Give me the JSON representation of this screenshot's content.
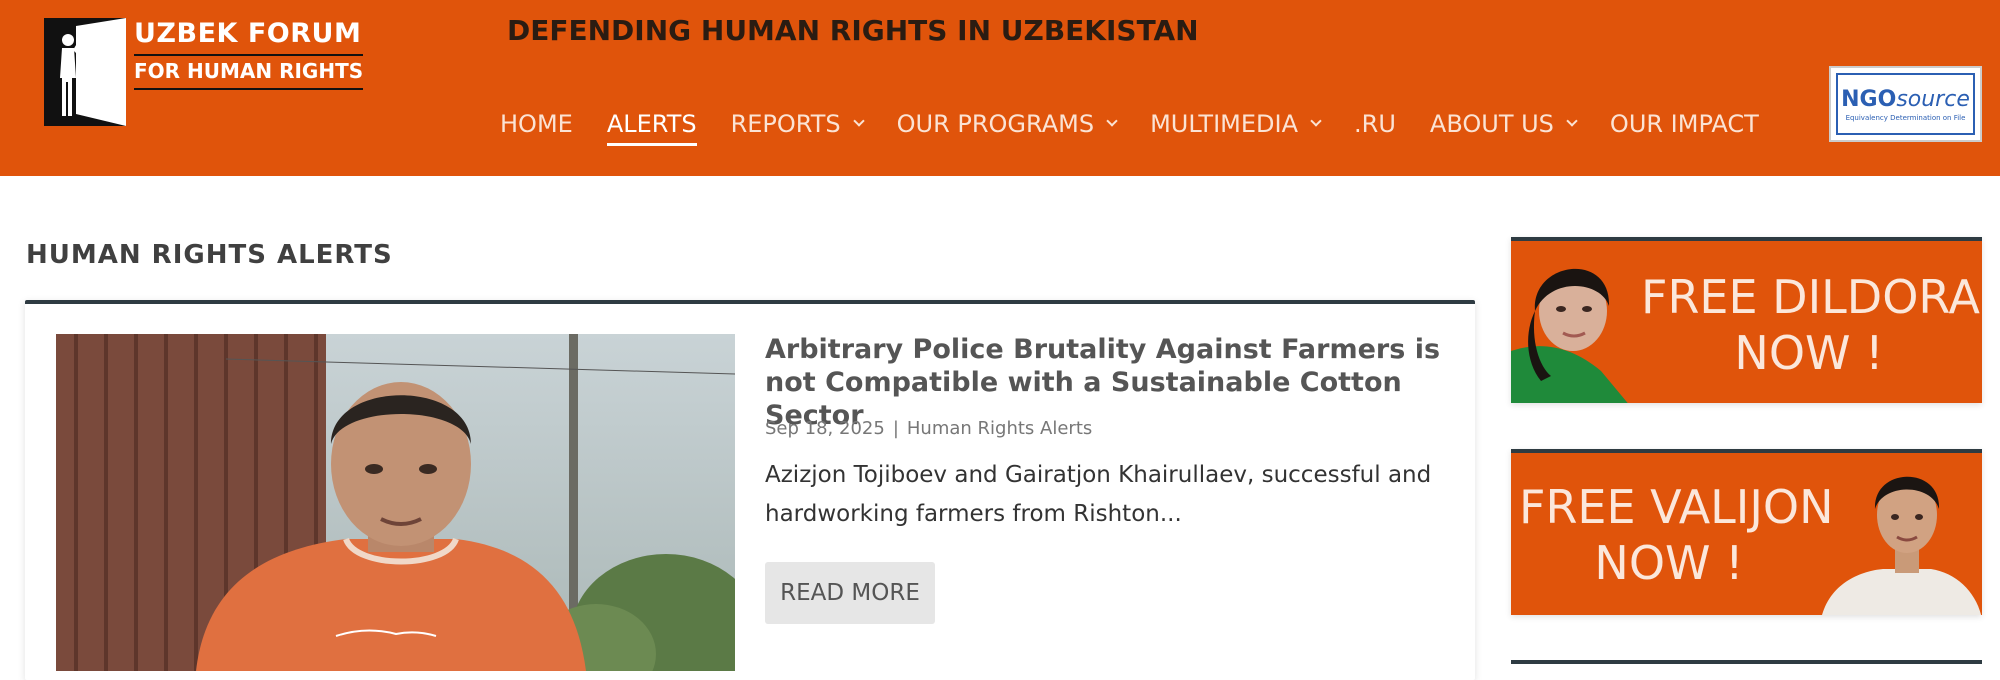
{
  "header": {
    "logo": {
      "line1": "UZBEK FORUM",
      "line2": "FOR HUMAN RIGHTS"
    },
    "tagline": "DEFENDING HUMAN RIGHTS IN UZBEKISTAN",
    "nav": [
      {
        "label": "HOME",
        "dropdown": false,
        "active": false
      },
      {
        "label": "ALERTS",
        "dropdown": false,
        "active": true
      },
      {
        "label": "REPORTS",
        "dropdown": true,
        "active": false
      },
      {
        "label": "OUR PROGRAMS",
        "dropdown": true,
        "active": false
      },
      {
        "label": "MULTIMEDIA",
        "dropdown": true,
        "active": false
      },
      {
        "label": ".RU",
        "dropdown": false,
        "active": false
      },
      {
        "label": "ABOUT US",
        "dropdown": true,
        "active": false
      },
      {
        "label": "OUR IMPACT",
        "dropdown": false,
        "active": false
      }
    ],
    "ngo_badge": {
      "brand_bold": "NGO",
      "brand_italic": "source",
      "subtitle": "Equivalency Determination on File"
    }
  },
  "main": {
    "section_title": "HUMAN RIGHTS ALERTS",
    "article": {
      "title": "Arbitrary Police Brutality Against Farmers is not Compatible with a Sustainable Cotton Sector",
      "date": "Sep 18, 2025",
      "separator": "|",
      "category": "Human Rights Alerts",
      "excerpt": "Azizjon Tojiboev and Gairatjon Khairullaev, successful and hardworking farmers from Rishton...",
      "read_more": "READ MORE"
    }
  },
  "sidebar": {
    "banners": [
      {
        "line1": "FREE DILDORA",
        "line2": "NOW !"
      },
      {
        "line1": "FREE VALIJON",
        "line2": "NOW !"
      }
    ]
  },
  "colors": {
    "brand_orange": "#e0540b",
    "dark_accent": "#2e3b42"
  }
}
